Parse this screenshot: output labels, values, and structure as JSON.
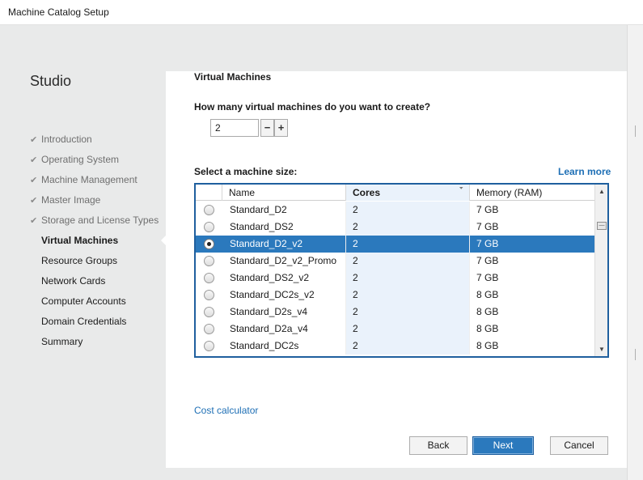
{
  "window": {
    "title": "Machine Catalog Setup"
  },
  "sidebar": {
    "product": "Studio",
    "steps": [
      {
        "label": "Introduction",
        "status": "done"
      },
      {
        "label": "Operating System",
        "status": "done"
      },
      {
        "label": "Machine Management",
        "status": "done"
      },
      {
        "label": "Master Image",
        "status": "done"
      },
      {
        "label": "Storage and License Types",
        "status": "done"
      },
      {
        "label": "Virtual Machines",
        "status": "current"
      },
      {
        "label": "Resource Groups",
        "status": "pending"
      },
      {
        "label": "Network Cards",
        "status": "pending"
      },
      {
        "label": "Computer Accounts",
        "status": "pending"
      },
      {
        "label": "Domain Credentials",
        "status": "pending"
      },
      {
        "label": "Summary",
        "status": "pending"
      }
    ]
  },
  "main": {
    "section_title": "Virtual Machines",
    "question": "How many virtual machines do you want to create?",
    "count_value": "2",
    "size_label": "Select a machine size:",
    "learn_more": "Learn more",
    "grid": {
      "columns": [
        "Name",
        "Cores",
        "Memory (RAM)"
      ],
      "sorted_column": "Cores",
      "rows": [
        {
          "name": "Standard_D2",
          "cores": "2",
          "memory": "7 GB",
          "selected": false
        },
        {
          "name": "Standard_DS2",
          "cores": "2",
          "memory": "7 GB",
          "selected": false
        },
        {
          "name": "Standard_D2_v2",
          "cores": "2",
          "memory": "7 GB",
          "selected": true
        },
        {
          "name": "Standard_D2_v2_Promo",
          "cores": "2",
          "memory": "7 GB",
          "selected": false
        },
        {
          "name": "Standard_DS2_v2",
          "cores": "2",
          "memory": "7 GB",
          "selected": false
        },
        {
          "name": "Standard_DC2s_v2",
          "cores": "2",
          "memory": "8 GB",
          "selected": false
        },
        {
          "name": "Standard_D2s_v4",
          "cores": "2",
          "memory": "8 GB",
          "selected": false
        },
        {
          "name": "Standard_D2a_v4",
          "cores": "2",
          "memory": "8 GB",
          "selected": false
        },
        {
          "name": "Standard_DC2s",
          "cores": "2",
          "memory": "8 GB",
          "selected": false
        }
      ]
    },
    "cost_calculator": "Cost calculator"
  },
  "buttons": {
    "back": "Back",
    "next": "Next",
    "cancel": "Cancel"
  },
  "colors": {
    "accent": "#2b79bd",
    "link": "#1e6fb5",
    "sidebar_bg": "#e9eaea"
  }
}
